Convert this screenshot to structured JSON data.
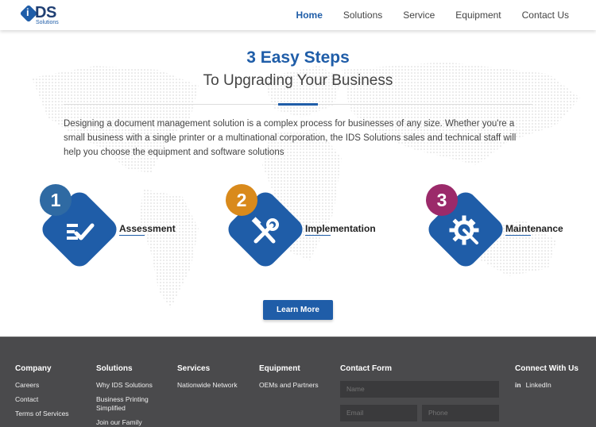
{
  "brand": {
    "logo_mark": "i",
    "logo_text": "DS",
    "logo_sub": "Solutions"
  },
  "nav": [
    {
      "label": "Home",
      "active": true
    },
    {
      "label": "Solutions",
      "active": false
    },
    {
      "label": "Service",
      "active": false
    },
    {
      "label": "Equipment",
      "active": false
    },
    {
      "label": "Contact Us",
      "active": false
    }
  ],
  "hero": {
    "title": "3 Easy Steps",
    "subtitle": "To Upgrading Your Business",
    "intro": "Designing a document management solution is a complex process for businesses of any size. Whether you're a small business with a single printer or a multinational corporation, the IDS Solutions sales and technical staff will help you choose the equipment and software solutions"
  },
  "steps": [
    {
      "number": "1",
      "label": "Assessment",
      "badge_color": "#2f6aa3",
      "icon": "checklist-icon"
    },
    {
      "number": "2",
      "label": "Implementation",
      "badge_color": "#d98a1c",
      "icon": "tools-icon"
    },
    {
      "number": "3",
      "label": "Maintenance",
      "badge_color": "#9b2a6a",
      "icon": "gear-wrench-icon"
    }
  ],
  "cta": {
    "label": "Learn More"
  },
  "footer": {
    "company": {
      "heading": "Company",
      "links": [
        "Careers",
        "Contact",
        "Terms of Services"
      ]
    },
    "solutions": {
      "heading": "Solutions",
      "links": [
        "Why IDS Solutions",
        "Business Printing Simplified",
        "Join our Family"
      ]
    },
    "services": {
      "heading": "Services",
      "links": [
        "Nationwide Network"
      ]
    },
    "equipment": {
      "heading": "Equipment",
      "links": [
        "OEMs and Partners"
      ]
    },
    "contact_form": {
      "heading": "Contact Form",
      "name_placeholder": "Name",
      "email_placeholder": "Email",
      "phone_placeholder": "Phone"
    },
    "connect": {
      "heading": "Connect With Us",
      "linkedin_icon": "in",
      "linkedin_label": "LinkedIn"
    }
  },
  "colors": {
    "primary": "#1f5da8",
    "footer_bg": "#4a4a4c"
  }
}
